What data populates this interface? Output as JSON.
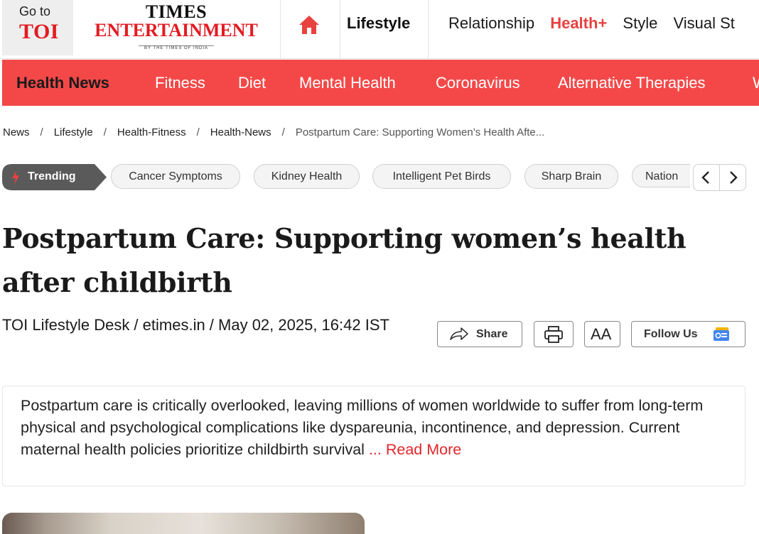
{
  "header": {
    "goto_label": "Go to",
    "goto_brand": "TOI",
    "brand_line1": "TIMES",
    "brand_line2": "ENTERTAINMENT",
    "brand_sub": "BY THE TIMES OF INDIA",
    "home_icon": "home-icon",
    "nav_lifestyle": "Lifestyle",
    "nav_items": [
      "Relationship",
      "Health+",
      "Style",
      "Visual St"
    ],
    "active_nav": "Health+"
  },
  "subnav": {
    "items": [
      "Health News",
      "Fitness",
      "Diet",
      "Mental Health",
      "Coronavirus",
      "Alternative Therapies",
      "W"
    ],
    "current": "Health News"
  },
  "breadcrumb": {
    "items": [
      "News",
      "Lifestyle",
      "Health-Fitness",
      "Health-News",
      "Postpartum Care: Supporting Women’s Health Afte..."
    ]
  },
  "trending": {
    "label": "Trending",
    "chips": [
      "Cancer Symptoms",
      "Kidney Health",
      "Intelligent Pet Birds",
      "Sharp Brain",
      "Nation"
    ]
  },
  "article": {
    "headline": "Postpartum Care: Supporting women’s health after childbirth",
    "byline": "TOI Lifestyle Desk / etimes.in / May 02, 2025, 16:42 IST",
    "share_label": "Share",
    "aa_label": "AA",
    "follow_label": "Follow Us",
    "summary": "Postpartum care is critically overlooked, leaving millions of women worldwide to suffer from long-term physical and psychological complications like dyspareunia, incontinence, and depression. Current maternal health policies prioritize childbirth survival ",
    "read_more": "... Read More"
  },
  "colors": {
    "brand_red": "#e21b22",
    "subnav_red": "#f44848",
    "active_nav": "#e8423f",
    "trending_bg": "#5a5a5a",
    "read_more": "#e0262b"
  }
}
